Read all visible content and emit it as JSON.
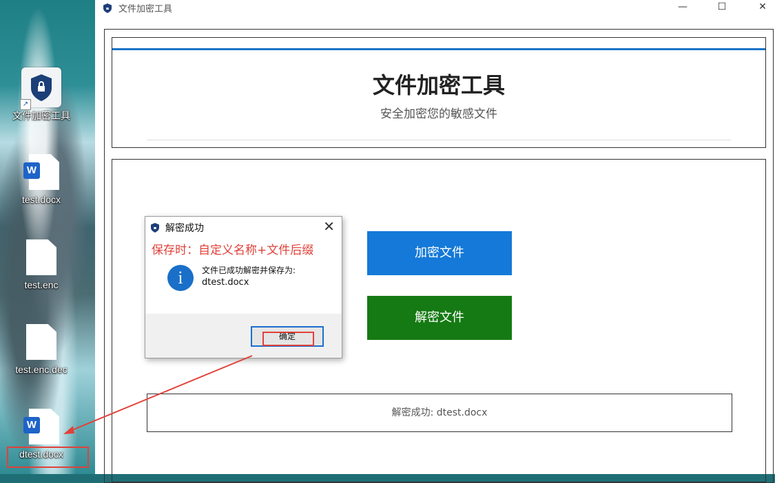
{
  "desktop": {
    "icons": [
      {
        "label": "文件加密工具",
        "type": "app-shortcut"
      },
      {
        "label": "test.docx",
        "type": "word"
      },
      {
        "label": "test.enc",
        "type": "file"
      },
      {
        "label": "test.enc.dec",
        "type": "file"
      },
      {
        "label": "dtest.docx",
        "type": "word"
      }
    ],
    "word_badge": "W"
  },
  "window": {
    "title": "文件加密工具",
    "controls": {
      "minimize": "—",
      "maximize": "☐",
      "close": "✕"
    }
  },
  "header": {
    "title": "文件加密工具",
    "subtitle": "安全加密您的敏感文件"
  },
  "actions": {
    "encrypt_label": "加密文件",
    "decrypt_label": "解密文件"
  },
  "status": {
    "text": "解密成功: dtest.docx"
  },
  "dialog": {
    "title": "解密成功",
    "annotation": "保存时：自定义名称+文件后缀",
    "message_line1": "文件已成功解密并保存为:",
    "message_line2": "dtest.docx",
    "ok_label": "确定",
    "info_glyph": "i",
    "close_glyph": "✕"
  },
  "colors": {
    "accent_blue": "#1479d8",
    "decrypt_green": "#157a13",
    "annotation_red": "#e0413a"
  }
}
